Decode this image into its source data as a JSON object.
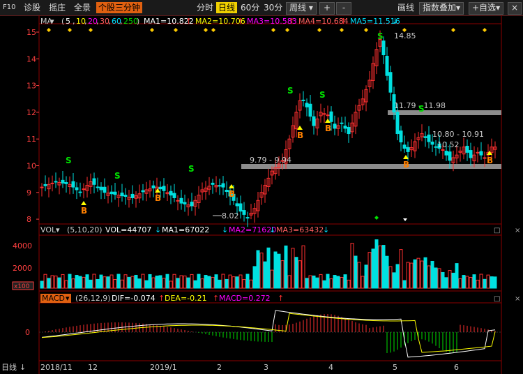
{
  "toolbar": {
    "f10": "F10",
    "items": [
      "诊股",
      "摇庄",
      "全景"
    ],
    "active_indicator": "个股三分钟",
    "periods": [
      "分时",
      "日线",
      "60分",
      "30分"
    ],
    "active_period": "日线",
    "week": "周线",
    "plus": "+",
    "minus": "-",
    "draw": "画线",
    "index_overlay": "指数叠加",
    "self_select": "+自选",
    "close": "×"
  },
  "main_chart": {
    "ma_label": "MA",
    "ma_params": [
      "5",
      "10",
      "20",
      "30",
      "60",
      "250"
    ],
    "ma_values": [
      {
        "name": "MA1",
        "value": "10.822",
        "color": "#ffffff"
      },
      {
        "name": "MA2",
        "value": "10.706",
        "color": "#ffff00"
      },
      {
        "name": "MA3",
        "value": "10.583",
        "color": "#ff00ff"
      },
      {
        "name": "MA4",
        "value": "10.684",
        "color": "#ff6060"
      },
      {
        "name": "MA5",
        "value": "11.516",
        "color": "#00e0ff"
      }
    ],
    "y_ticks": [
      "15",
      "14",
      "13",
      "12",
      "11",
      "10",
      "9",
      "8"
    ],
    "annotations": {
      "high": "14.85",
      "low": "8.02",
      "range1": "9.79 - 9.94",
      "range2": "11.79 - 11.98",
      "range3": "10.80 - 10.91",
      "range4": "10.52"
    },
    "signal_buy": "B",
    "signal_sell": "S"
  },
  "volume": {
    "label": "VOL",
    "params": "(5,10,20)",
    "vol": "VOL=44707",
    "ma1": "MA1=67022",
    "ma2": "MA2=71620",
    "ma3": "MA3=63432",
    "y_ticks": [
      "4000",
      "2000"
    ],
    "unit": "x100"
  },
  "macd": {
    "label": "MACD",
    "params": "(26,12,9)",
    "dif": "DIF=-0.074",
    "dea": "DEA=-0.21",
    "macd": "MACD=0.272",
    "y_tick": "0"
  },
  "x_axis": {
    "period_label": "日线",
    "labels": [
      "2018/11",
      "12",
      "2019/1",
      "2",
      "3",
      "4",
      "5",
      "6"
    ]
  },
  "colors": {
    "up": "#ff3030",
    "down": "#00e0e0",
    "grid": "#8b0000",
    "axis_text": "#ff4040"
  }
}
